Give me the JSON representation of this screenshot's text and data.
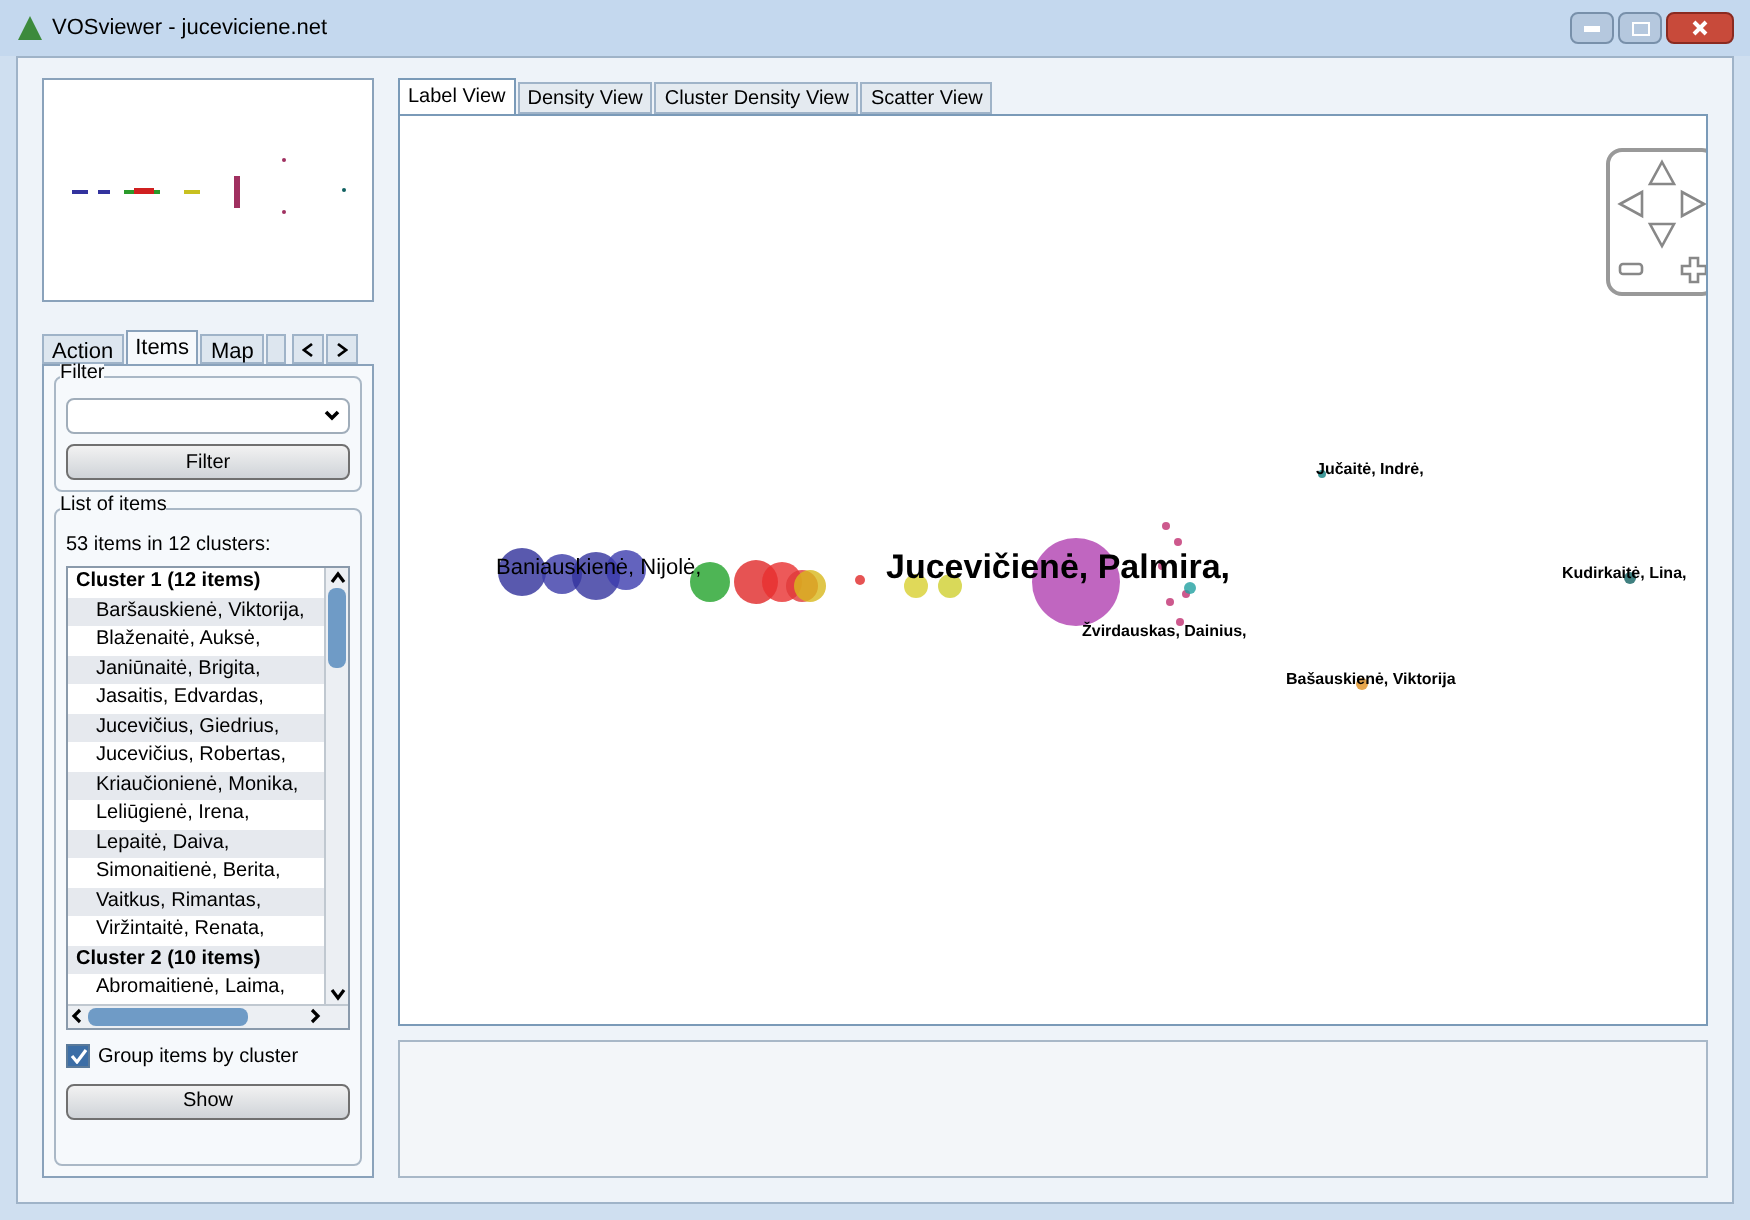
{
  "window": {
    "title": "VOSviewer - juceviciene.net"
  },
  "left_tabs": [
    {
      "label": "Action",
      "selected": false
    },
    {
      "label": "Items",
      "selected": true
    },
    {
      "label": "Map",
      "selected": false
    },
    {
      "selected": false
    }
  ],
  "filter": {
    "title": "Filter",
    "button": "Filter"
  },
  "list": {
    "title": "List of items",
    "summary": "53 items in 12 clusters:",
    "rows": [
      {
        "kind": "header",
        "text": "Cluster 1 (12 items)"
      },
      {
        "kind": "item",
        "text": "Baršauskienė, Viktorija,"
      },
      {
        "kind": "item",
        "text": "Blaženaitė, Auksė,"
      },
      {
        "kind": "item",
        "text": "Janiūnaitė, Brigita,"
      },
      {
        "kind": "item",
        "text": "Jasaitis, Edvardas,"
      },
      {
        "kind": "item",
        "text": "Jucevičius, Giedrius,"
      },
      {
        "kind": "item",
        "text": "Jucevičius, Robertas,"
      },
      {
        "kind": "item",
        "text": "Kriaučionienė, Monika,"
      },
      {
        "kind": "item",
        "text": "Leliūgienė, Irena,"
      },
      {
        "kind": "item",
        "text": "Lepaitė, Daiva,"
      },
      {
        "kind": "item",
        "text": "Simonaitienė, Berita,"
      },
      {
        "kind": "item",
        "text": "Vaitkus, Rimantas,"
      },
      {
        "kind": "item",
        "text": "Viržintaitė, Renata,"
      },
      {
        "kind": "header",
        "text": "Cluster 2 (10 items)"
      },
      {
        "kind": "item",
        "text": "Abromaitienė, Laima,"
      }
    ],
    "group_by_cluster": {
      "label": "Group items by cluster",
      "checked": true
    },
    "button": "Show"
  },
  "view_tabs": [
    {
      "label": "Label View",
      "selected": true
    },
    {
      "label": "Density View",
      "selected": false
    },
    {
      "label": "Cluster Density View",
      "selected": false
    },
    {
      "label": "Scatter View",
      "selected": false
    }
  ],
  "map_labels": [
    {
      "text": "Baniauskienė, Nijolė,",
      "kind": "medium"
    },
    {
      "text": "Jucevičienė, Palmira,",
      "kind": "major"
    },
    {
      "text": "Jučaitė, Indrė,",
      "kind": "minor"
    },
    {
      "text": "Žvirdauskas, Dainius,",
      "kind": "minor"
    },
    {
      "text": "Bašauskienė, Viktorija",
      "kind": "minor"
    },
    {
      "text": "Kudirkaitė, Lina,",
      "kind": "minor"
    }
  ]
}
